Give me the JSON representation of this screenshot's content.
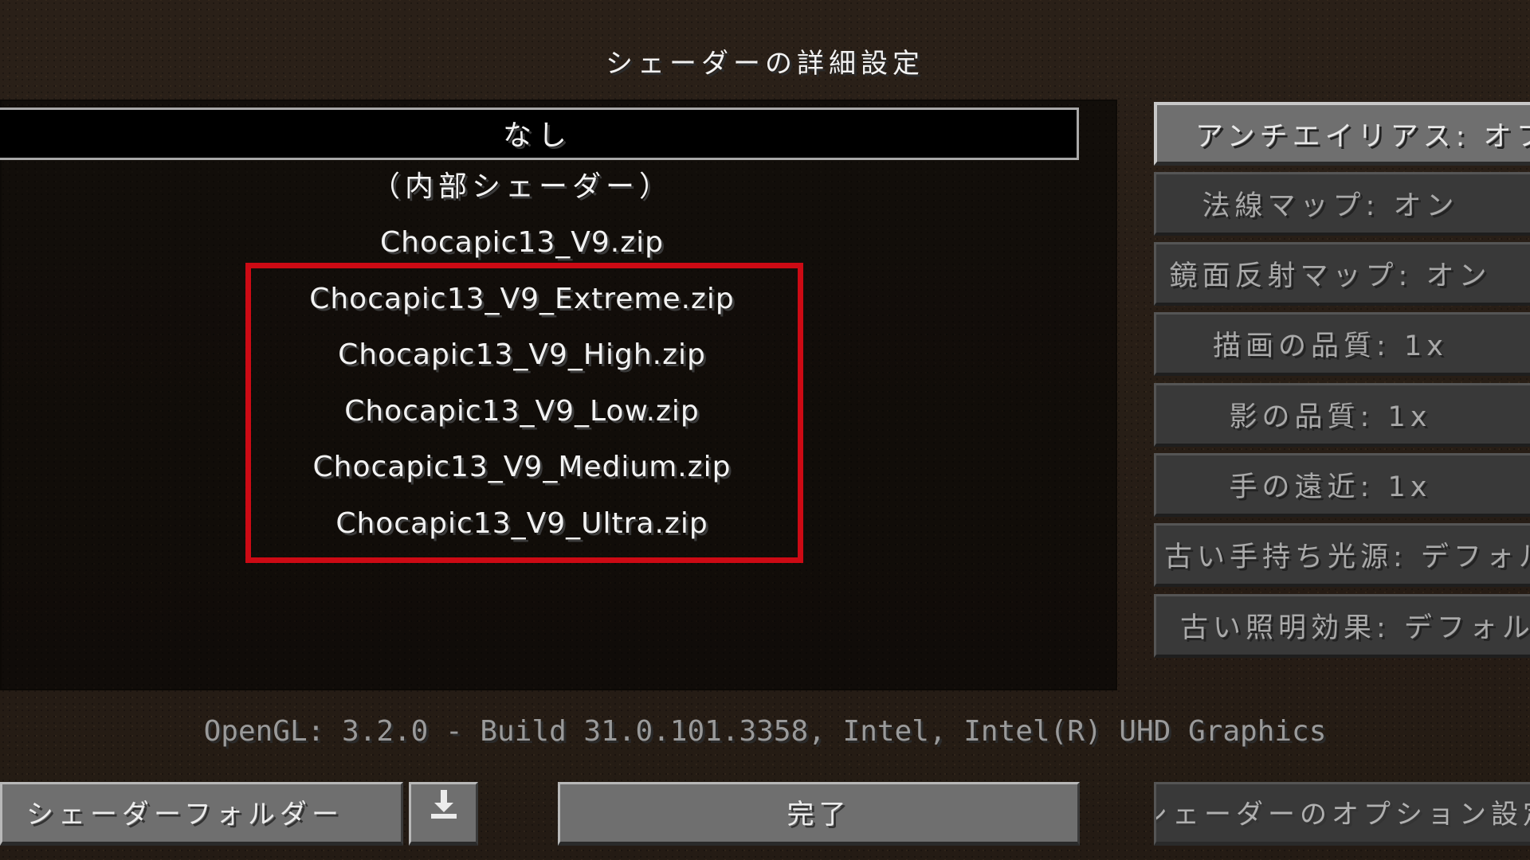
{
  "screen": {
    "title": "シェーダーの詳細設定"
  },
  "shader_list": {
    "selected": "なし",
    "internal": "（内部シェーダー）",
    "items": [
      "Chocapic13_V9.zip",
      "Chocapic13_V9_Extreme.zip",
      "Chocapic13_V9_High.zip",
      "Chocapic13_V9_Low.zip",
      "Chocapic13_V9_Medium.zip",
      "Chocapic13_V9_Ultra.zip"
    ]
  },
  "options": [
    "アンチエイリアス: オフ",
    "法線マップ: オン",
    "鏡面反射マップ: オン",
    "描画の品質: 1x",
    "影の品質: 1x",
    "手の遠近: 1x",
    "古い手持ち光源: デフォルト",
    "古い照明効果: デフォルト"
  ],
  "opengl_info": "OpenGL: 3.2.0 - Build 31.0.101.3358, Intel, Intel(R) UHD Graphics",
  "bottom": {
    "folder_label": "シェーダーフォルダー",
    "done_label": "完了",
    "options_label": "シェーダーのオプション設定"
  },
  "icons": {
    "download": "download-icon"
  },
  "colors": {
    "highlight": "#cc0a14",
    "button_active": "#6f6f6f",
    "button_dark": "#393939"
  }
}
